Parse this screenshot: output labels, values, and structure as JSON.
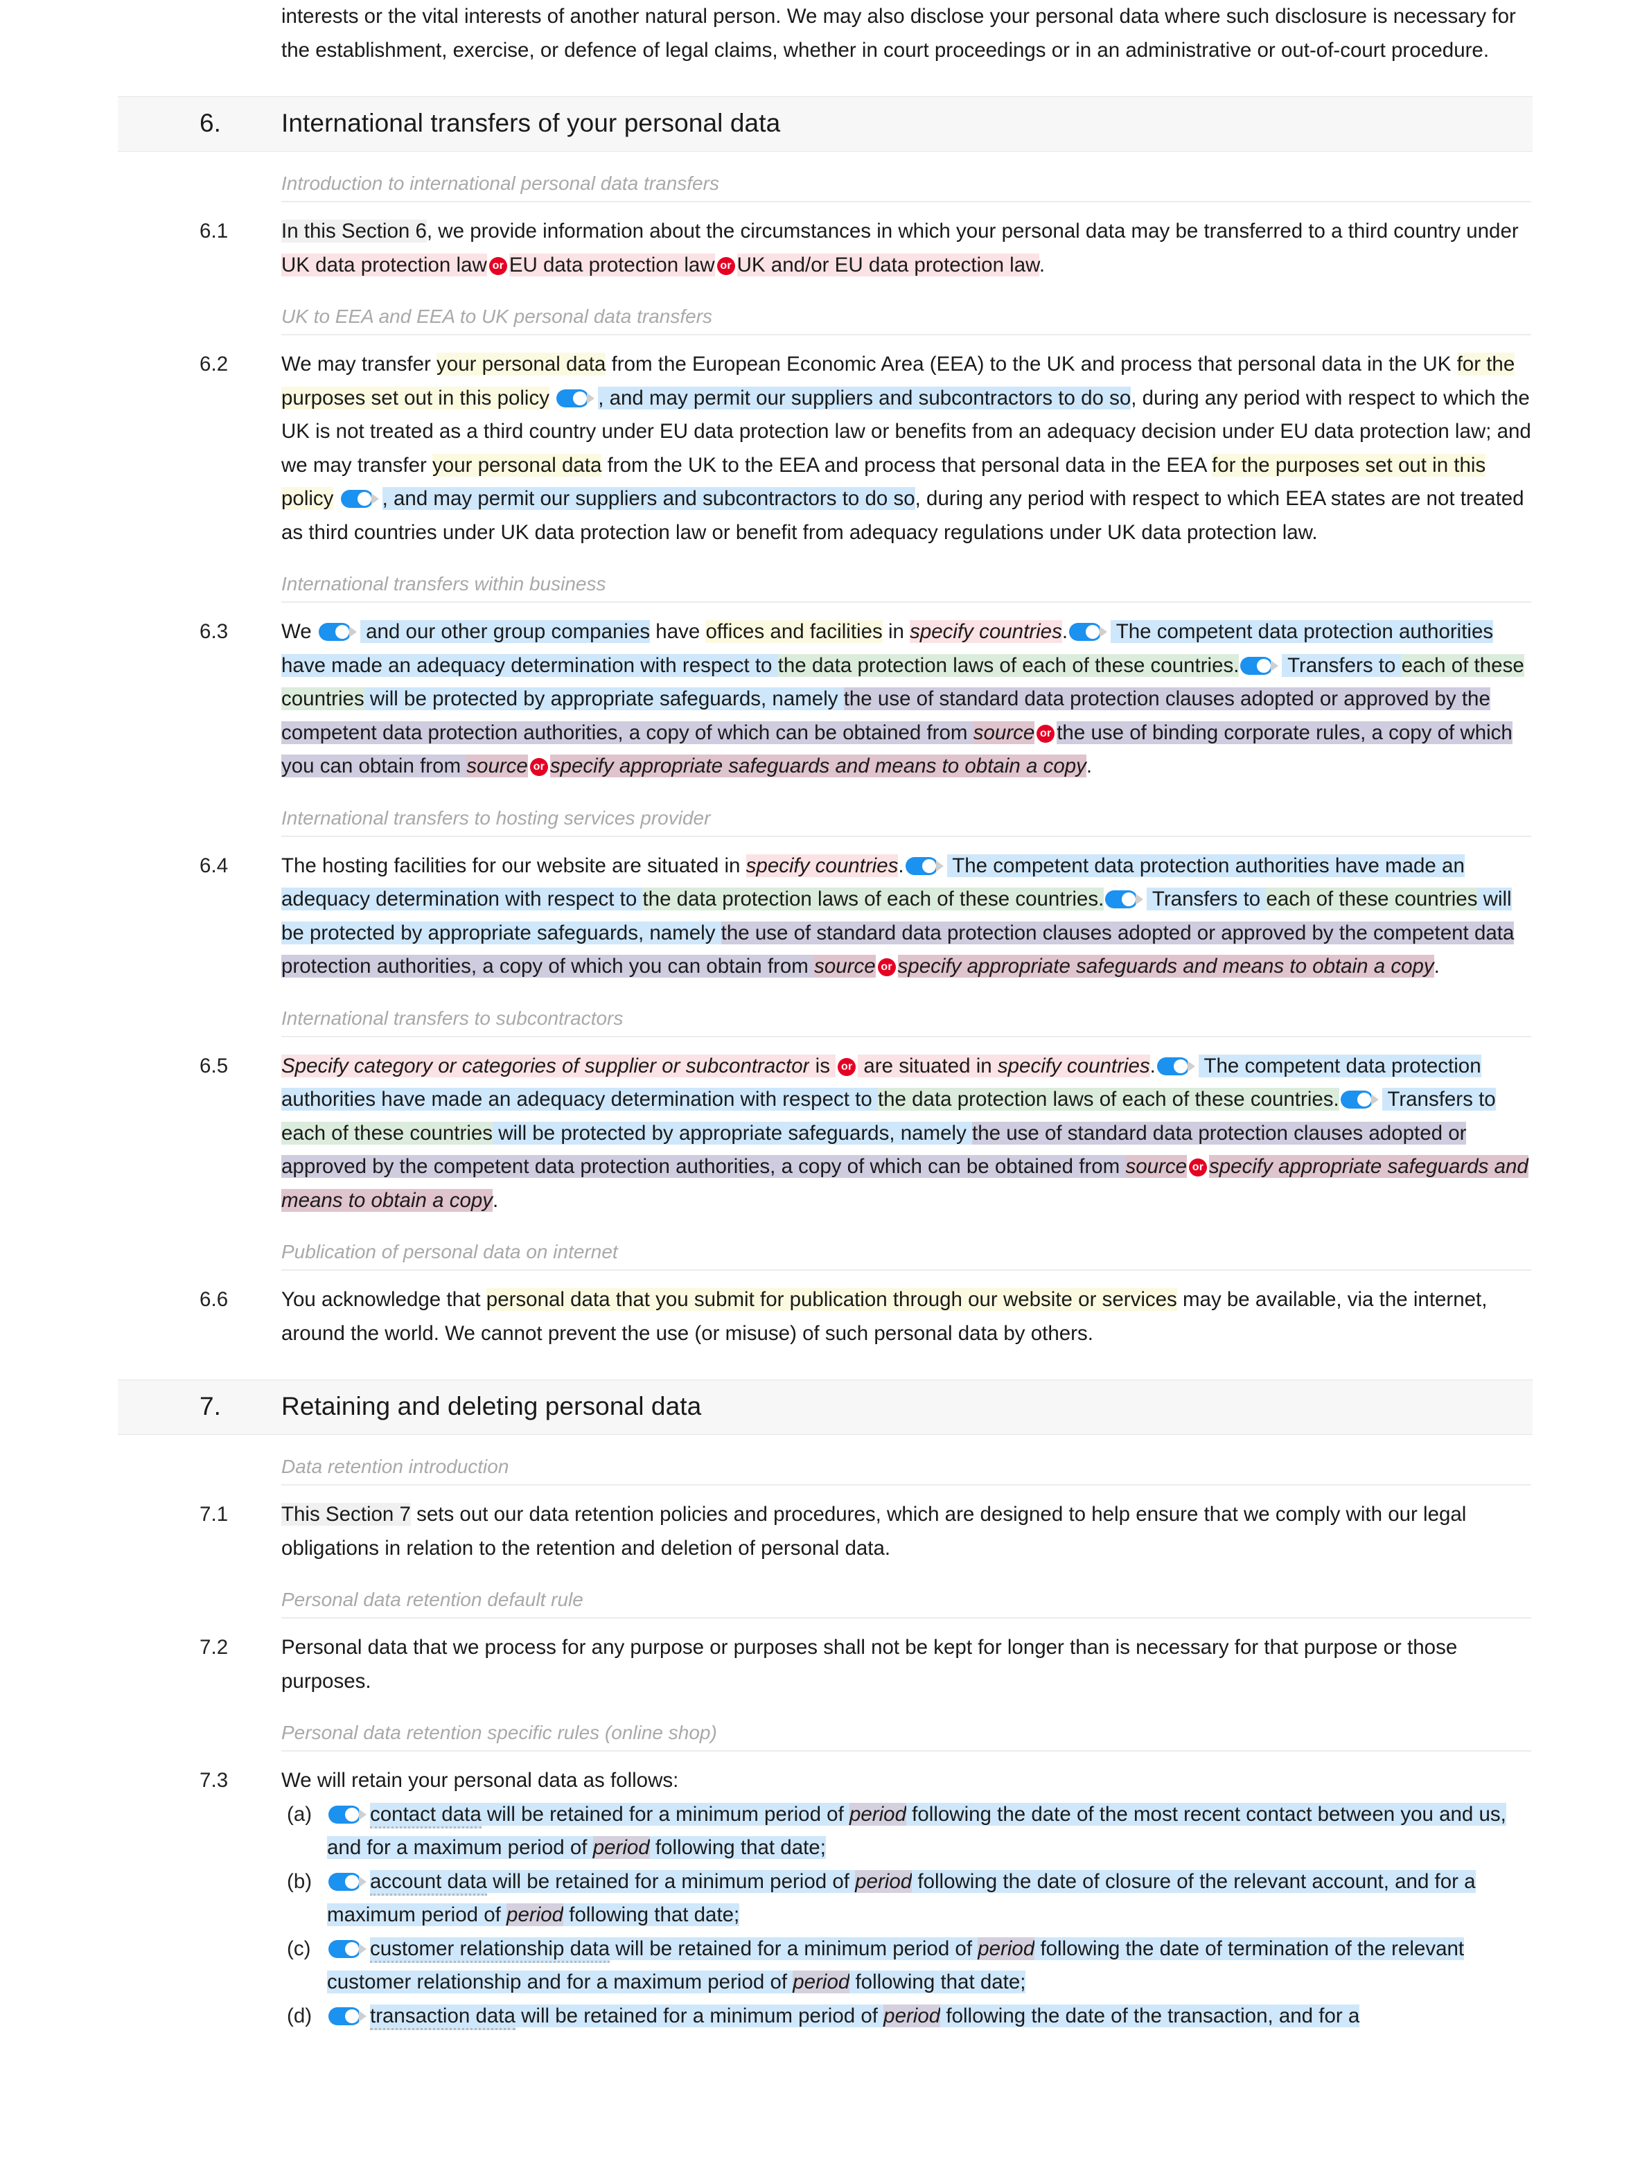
{
  "document": {
    "type": "privacy-policy-template",
    "intro_continuation": {
      "text": "interests or the vital interests of another natural person. We may also disclose your personal data where such disclosure is necessary for the establishment, exercise, or defence of legal claims, whether in court proceedings or in an administrative or out-of-court procedure."
    },
    "sections": [
      {
        "number": "6.",
        "title": "International transfers of your personal data",
        "subheads": [
          "Introduction to international personal data transfers",
          "UK to EEA and EEA to UK personal data transfers",
          "International transfers within business",
          "International transfers to hosting services provider",
          "International transfers to subcontractors",
          "Publication of personal data on internet"
        ],
        "clauses": [
          {
            "num": "6.1",
            "parts": [
              {
                "t": "In this Section 6",
                "hl": "grey"
              },
              {
                "t": ", we provide information about the circumstances in which your personal data may be transferred to a third country under ",
                "hl": ""
              },
              {
                "t": "UK data protection law",
                "hl": "pink"
              },
              {
                "t": "or",
                "hl": "badge"
              },
              {
                "t": "EU data protection law",
                "hl": "pink"
              },
              {
                "t": "or",
                "hl": "badge"
              },
              {
                "t": "UK and/or EU data protection law",
                "hl": "pink"
              },
              {
                "t": ".",
                "hl": ""
              }
            ]
          },
          {
            "num": "6.2",
            "parts": [
              {
                "t": "We may transfer ",
                "hl": ""
              },
              {
                "t": "your personal data",
                "hl": "yellow"
              },
              {
                "t": " from the European Economic Area (EEA) to the UK and process that personal data in the UK ",
                "hl": ""
              },
              {
                "t": "for the purposes set out in this policy",
                "hl": "yellow"
              },
              {
                "t": " ",
                "hl": ""
              },
              {
                "t": "toggle",
                "hl": "toggle"
              },
              {
                "t": ", and may permit our suppliers and subcontractors to do so",
                "hl": "blue"
              },
              {
                "t": ", during any period with respect to which the UK is not treated as a third country under EU data protection law or benefits from an adequacy decision under EU data protection law; and we may transfer ",
                "hl": ""
              },
              {
                "t": "your personal data",
                "hl": "yellow"
              },
              {
                "t": " from the UK to the EEA and process that personal data in the EEA ",
                "hl": ""
              },
              {
                "t": "for the purposes set out in this policy",
                "hl": "yellow"
              },
              {
                "t": " ",
                "hl": ""
              },
              {
                "t": "toggle",
                "hl": "toggle"
              },
              {
                "t": ", and may permit our suppliers and subcontractors to do so",
                "hl": "blue"
              },
              {
                "t": ", during any period with respect to which EEA states are not treated as third countries under UK data protection law or benefit from adequacy regulations under UK data protection law.",
                "hl": ""
              }
            ]
          },
          {
            "num": "6.3",
            "parts": [
              {
                "t": "We ",
                "hl": ""
              },
              {
                "t": "toggle",
                "hl": "toggle"
              },
              {
                "t": " and our other group companies",
                "hl": "blue"
              },
              {
                "t": " have ",
                "hl": ""
              },
              {
                "t": "offices and facilities",
                "hl": "yellow"
              },
              {
                "t": " in ",
                "hl": ""
              },
              {
                "t": "specify countries",
                "hl": "pink-ital"
              },
              {
                "t": ".",
                "hl": ""
              },
              {
                "t": "toggle",
                "hl": "toggle"
              },
              {
                "t": " The competent data protection authorities have made an adequacy determination with respect to ",
                "hl": "blue"
              },
              {
                "t": "the data protection laws of each of these countries.",
                "hl": "green"
              },
              {
                "t": "toggle",
                "hl": "toggle"
              },
              {
                "t": " Transfers to ",
                "hl": "blue"
              },
              {
                "t": "each of these countries",
                "hl": "green"
              },
              {
                "t": " will be protected by appropriate safeguards, namely ",
                "hl": "blue"
              },
              {
                "t": "the use of standard data protection clauses adopted or approved by the competent data protection authorities, a copy of which can be obtained from ",
                "hl": "purple"
              },
              {
                "t": "source",
                "hl": "rose-ital"
              },
              {
                "t": "or",
                "hl": "badge"
              },
              {
                "t": "the use of binding corporate rules, a copy of which you can obtain from ",
                "hl": "purple"
              },
              {
                "t": "source",
                "hl": "rose-ital"
              },
              {
                "t": "or",
                "hl": "badge"
              },
              {
                "t": "specify appropriate safeguards and means to obtain a copy",
                "hl": "rose-ital"
              },
              {
                "t": ".",
                "hl": ""
              }
            ]
          },
          {
            "num": "6.4",
            "parts": [
              {
                "t": "The hosting facilities for our website are situated in ",
                "hl": ""
              },
              {
                "t": "specify countries",
                "hl": "pink-ital"
              },
              {
                "t": ".",
                "hl": ""
              },
              {
                "t": "toggle",
                "hl": "toggle"
              },
              {
                "t": " The competent data protection authorities have made an adequacy determination with respect to ",
                "hl": "blue"
              },
              {
                "t": "the data protection laws of each of these countries.",
                "hl": "green"
              },
              {
                "t": "toggle",
                "hl": "toggle"
              },
              {
                "t": " Transfers to ",
                "hl": "blue"
              },
              {
                "t": "each of these countries",
                "hl": "green"
              },
              {
                "t": " will be protected by appropriate safeguards, namely ",
                "hl": "blue"
              },
              {
                "t": "the use of standard data protection clauses adopted or approved by the competent data protection authorities, a copy of which you can obtain from ",
                "hl": "purple"
              },
              {
                "t": "source",
                "hl": "rose-ital"
              },
              {
                "t": "or",
                "hl": "badge"
              },
              {
                "t": "specify appropriate safeguards and means to obtain a copy",
                "hl": "rose-ital"
              },
              {
                "t": ".",
                "hl": ""
              }
            ]
          },
          {
            "num": "6.5",
            "parts": [
              {
                "t": "Specify category or categories of supplier or subcontractor",
                "hl": "pink-ital"
              },
              {
                "t": " is ",
                "hl": "pink"
              },
              {
                "t": "or",
                "hl": "badge"
              },
              {
                "t": " are situated in ",
                "hl": "pink"
              },
              {
                "t": "specify countries",
                "hl": "pink-ital"
              },
              {
                "t": ".",
                "hl": ""
              },
              {
                "t": "toggle",
                "hl": "toggle"
              },
              {
                "t": " The competent data protection authorities have made an adequacy determination with respect to ",
                "hl": "blue"
              },
              {
                "t": "the data protection laws of each of these countries.",
                "hl": "green"
              },
              {
                "t": "toggle",
                "hl": "toggle"
              },
              {
                "t": " Transfers to ",
                "hl": "blue"
              },
              {
                "t": "each of these countries",
                "hl": "green"
              },
              {
                "t": " will be protected by appropriate safeguards, namely ",
                "hl": "blue"
              },
              {
                "t": "the use of standard data protection clauses adopted or approved by the competent data protection authorities, a copy of which can be obtained from ",
                "hl": "purple"
              },
              {
                "t": "source",
                "hl": "rose-ital"
              },
              {
                "t": "or",
                "hl": "badge"
              },
              {
                "t": "specify appropriate safeguards and means to obtain a copy",
                "hl": "rose-ital"
              },
              {
                "t": ".",
                "hl": ""
              }
            ]
          },
          {
            "num": "6.6",
            "parts": [
              {
                "t": "You acknowledge that ",
                "hl": ""
              },
              {
                "t": "personal data that you submit for publication through our website or services",
                "hl": "yellow"
              },
              {
                "t": " may be available, via the internet, around the world. We cannot prevent the use (or misuse) of such personal data by others.",
                "hl": ""
              }
            ]
          }
        ]
      },
      {
        "number": "7.",
        "title": "Retaining and deleting personal data",
        "subheads": [
          "Data retention introduction",
          "Personal data retention default rule",
          "Personal data retention specific rules (online shop)"
        ],
        "clauses": [
          {
            "num": "7.1",
            "parts": [
              {
                "t": "This Section 7",
                "hl": "grey"
              },
              {
                "t": " sets out our data retention policies and procedures, which are designed to help ensure that we comply with our legal obligations in relation to the retention and deletion of personal data.",
                "hl": ""
              }
            ]
          },
          {
            "num": "7.2",
            "parts": [
              {
                "t": "Personal data that we process for any purpose or purposes shall not be kept for longer than is necessary for that purpose or those purposes.",
                "hl": ""
              }
            ]
          },
          {
            "num": "7.3",
            "parts": [
              {
                "t": "We will retain your personal data as follows:",
                "hl": ""
              }
            ],
            "sublist": [
              {
                "letter": "(a)",
                "parts": [
                  {
                    "t": "toggle",
                    "hl": "toggle"
                  },
                  {
                    "t": "contact data",
                    "hl": "blue-dotted"
                  },
                  {
                    "t": " will be retained for a minimum period of ",
                    "hl": "blue"
                  },
                  {
                    "t": "period",
                    "hl": "lav-ital"
                  },
                  {
                    "t": " following the date of the most recent contact between you and us, and for a maximum period of ",
                    "hl": "blue"
                  },
                  {
                    "t": "period",
                    "hl": "lav-ital"
                  },
                  {
                    "t": " following that date;",
                    "hl": "blue"
                  }
                ]
              },
              {
                "letter": "(b)",
                "parts": [
                  {
                    "t": "toggle",
                    "hl": "toggle"
                  },
                  {
                    "t": "account data",
                    "hl": "blue-dotted"
                  },
                  {
                    "t": " will be retained for a minimum period of ",
                    "hl": "blue"
                  },
                  {
                    "t": "period",
                    "hl": "lav-ital"
                  },
                  {
                    "t": " following the date of closure of the relevant account, and for a maximum period of ",
                    "hl": "blue"
                  },
                  {
                    "t": "period",
                    "hl": "lav-ital"
                  },
                  {
                    "t": " following that date;",
                    "hl": "blue"
                  }
                ]
              },
              {
                "letter": "(c)",
                "parts": [
                  {
                    "t": "toggle",
                    "hl": "toggle"
                  },
                  {
                    "t": "customer relationship data",
                    "hl": "blue-dotted"
                  },
                  {
                    "t": " will be retained for a minimum period of ",
                    "hl": "blue"
                  },
                  {
                    "t": "period",
                    "hl": "lav-ital"
                  },
                  {
                    "t": " following the date of termination of the relevant customer relationship and for a maximum period of ",
                    "hl": "blue"
                  },
                  {
                    "t": "period",
                    "hl": "lav-ital"
                  },
                  {
                    "t": " following that date;",
                    "hl": "blue"
                  }
                ]
              },
              {
                "letter": "(d)",
                "parts": [
                  {
                    "t": "toggle",
                    "hl": "toggle"
                  },
                  {
                    "t": "transaction data",
                    "hl": "blue-dotted"
                  },
                  {
                    "t": " will be retained for a minimum period of ",
                    "hl": "blue"
                  },
                  {
                    "t": "period",
                    "hl": "lav-ital"
                  },
                  {
                    "t": " following the date of the transaction, and for a",
                    "hl": "blue"
                  }
                ]
              }
            ]
          }
        ]
      }
    ],
    "icons": {
      "toggle": "toggle-switch-on-icon",
      "or": "or-alternative-badge",
      "arrow": "expand-arrow-icon"
    },
    "colors": {
      "toggle_blue": "#1b91f0",
      "or_red": "#e60023",
      "hl_blue": "#cfe7fa",
      "hl_yellow": "#fbfae0",
      "hl_green": "#dcecdc",
      "hl_purple": "#cfccdf",
      "hl_pink": "#fbe2e4",
      "hl_rose": "#dfc3cd",
      "hl_lavender": "#d5d0de",
      "section_head_bg": "#f7f7f7",
      "subhead_grey": "#a9a9a9"
    }
  }
}
